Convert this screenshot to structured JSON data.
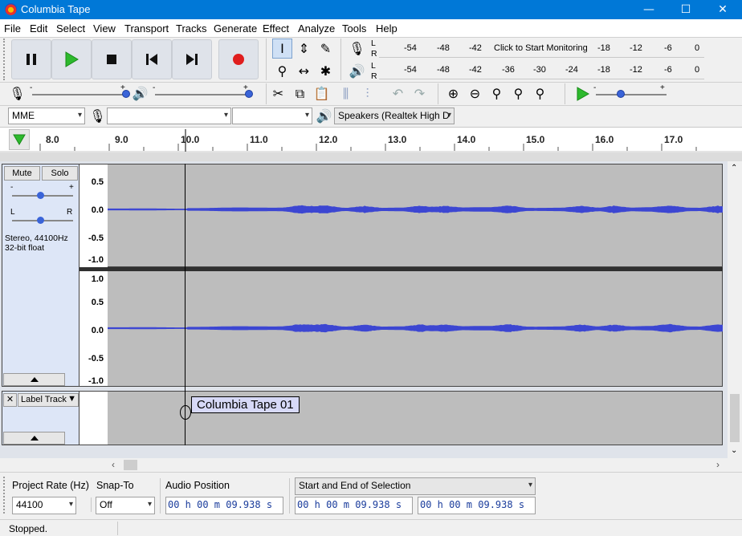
{
  "window": {
    "title": "Columbia Tape",
    "minimize": "—",
    "maximize": "☐",
    "close": "✕"
  },
  "menu": [
    "File",
    "Edit",
    "Select",
    "View",
    "Transport",
    "Tracks",
    "Generate",
    "Effect",
    "Analyze",
    "Tools",
    "Help"
  ],
  "meters": {
    "record_ticks": [
      "-54",
      "-48",
      "-42",
      "Click to Start Monitoring",
      "-18",
      "-12",
      "-6",
      "0"
    ],
    "play_ticks": [
      "-54",
      "-48",
      "-42",
      "-36",
      "-30",
      "-24",
      "-18",
      "-12",
      "-6",
      "0"
    ],
    "L": "L",
    "R": "R"
  },
  "device": {
    "host": "MME",
    "input": "",
    "channels": "",
    "output": "Speakers (Realtek High D"
  },
  "ruler": {
    "labels": [
      "8.0",
      "9.0",
      "10.0",
      "11.0",
      "12.0",
      "13.0",
      "14.0",
      "15.0",
      "16.0",
      "17.0"
    ]
  },
  "track": {
    "mute": "Mute",
    "solo": "Solo",
    "minus": "-",
    "plus": "+",
    "L": "L",
    "R": "R",
    "info_line1": "Stereo, 44100Hz",
    "info_line2": "32-bit float",
    "scale_top": [
      "0.5",
      "0.0",
      "-0.5",
      "-1.0"
    ],
    "scale_bottom": [
      "1.0",
      "0.5",
      "0.0",
      "-0.5",
      "-1.0"
    ]
  },
  "label_track": {
    "name": "Label Track",
    "close": "✕",
    "label_text": "Columbia Tape 01"
  },
  "selection_toolbar": {
    "project_rate_label": "Project Rate (Hz)",
    "project_rate_value": "44100",
    "snap_to_label": "Snap-To",
    "snap_to_value": "Off",
    "audio_position_label": "Audio Position",
    "audio_position_value": "00 h 00 m 09.938 s",
    "selection_mode": "Start and End of Selection",
    "selection_start": "00 h 00 m 09.938 s",
    "selection_end": "00 h 00 m 09.938 s"
  },
  "status": {
    "text": "Stopped."
  },
  "colors": {
    "titlebar": "#0078d7",
    "waveform": "#3c46d2",
    "record": "#e01e1e",
    "play": "#2db92d"
  }
}
